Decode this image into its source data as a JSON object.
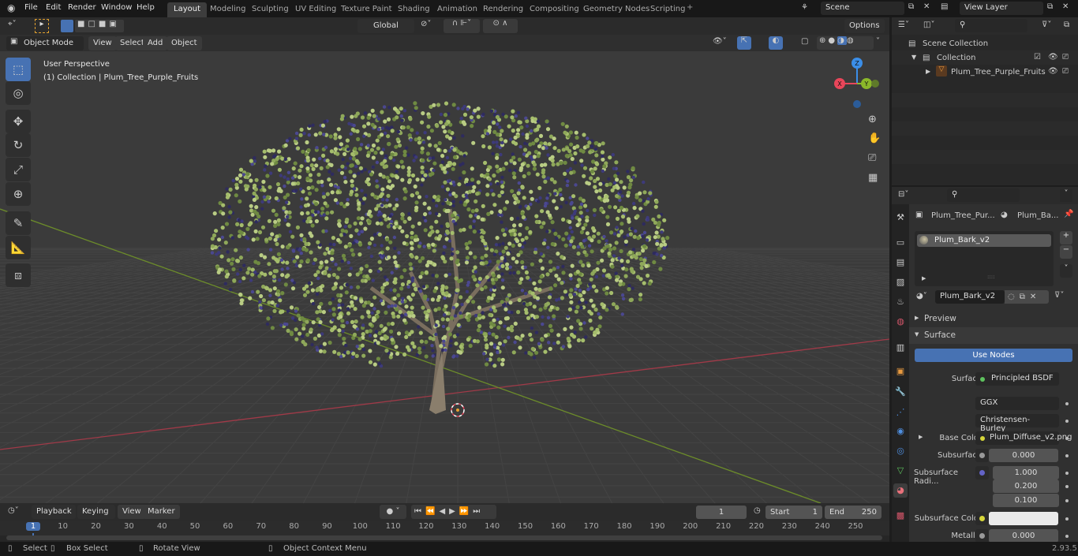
{
  "menus": [
    "File",
    "Edit",
    "Render",
    "Window",
    "Help"
  ],
  "workspaces": [
    "Layout",
    "Modeling",
    "Sculpting",
    "UV Editing",
    "Texture Paint",
    "Shading",
    "Animation",
    "Rendering",
    "Compositing",
    "Geometry Nodes",
    "Scripting"
  ],
  "active_workspace": "Layout",
  "scene": "Scene",
  "view_layer": "View Layer",
  "viewport": {
    "mode": "Object Mode",
    "menus": [
      "View",
      "Select",
      "Add",
      "Object"
    ],
    "transform": "Global",
    "options": "Options",
    "overlay_title": "User Perspective",
    "overlay_sub": "(1) Collection | Plum_Tree_Purple_Fruits",
    "gizmo": {
      "x": "X",
      "y": "Y",
      "z": "Z"
    },
    "tools": [
      "select-box",
      "cursor",
      "move",
      "rotate",
      "scale",
      "transform",
      "annotate",
      "measure",
      "add-cube"
    ]
  },
  "outliner": {
    "root": "Scene Collection",
    "collection": "Collection",
    "object": "Plum_Tree_Purple_Fruits"
  },
  "properties": {
    "object": "Plum_Tree_Pur...",
    "material_short": "Plum_Ba...",
    "slot": "Plum_Bark_v2",
    "material": "Plum_Bark_v2",
    "preview": "Preview",
    "surface_panel": "Surface",
    "use_nodes": "Use Nodes",
    "surface_label": "Surface",
    "surface_value": "Principled BSDF",
    "distribution": "GGX",
    "sss_method": "Christensen-Burley",
    "base_color_label": "Base Color",
    "base_color_value": "Plum_Diffuse_v2.png",
    "subsurface_label": "Subsurface",
    "subsurface_value": "0.000",
    "radius_label": "Subsurface Radi...",
    "radius": [
      "1.000",
      "0.200",
      "0.100"
    ],
    "sss_color_label": "Subsurface Color",
    "metallic_label": "Metallic",
    "metallic_value": "0.000"
  },
  "timeline": {
    "menus": [
      "Playback",
      "Keying",
      "View",
      "Marker"
    ],
    "current_frame": "1",
    "start_label": "Start",
    "start": "1",
    "end_label": "End",
    "end": "250",
    "ticks": [
      1,
      10,
      20,
      30,
      40,
      50,
      60,
      70,
      80,
      90,
      100,
      110,
      120,
      130,
      140,
      150,
      160,
      170,
      180,
      190,
      200,
      210,
      220,
      230,
      240,
      250
    ]
  },
  "status": {
    "select": "Select",
    "box_select": "Box Select",
    "rotate": "Rotate View",
    "context": "Object Context Menu",
    "version": "2.93.5"
  },
  "colors": {
    "accent": "#4772b3",
    "x_axis": "#e8465a",
    "y_axis": "#8bb82a",
    "z_axis": "#3b8ee8",
    "active_tab": "#3d3d3d"
  }
}
